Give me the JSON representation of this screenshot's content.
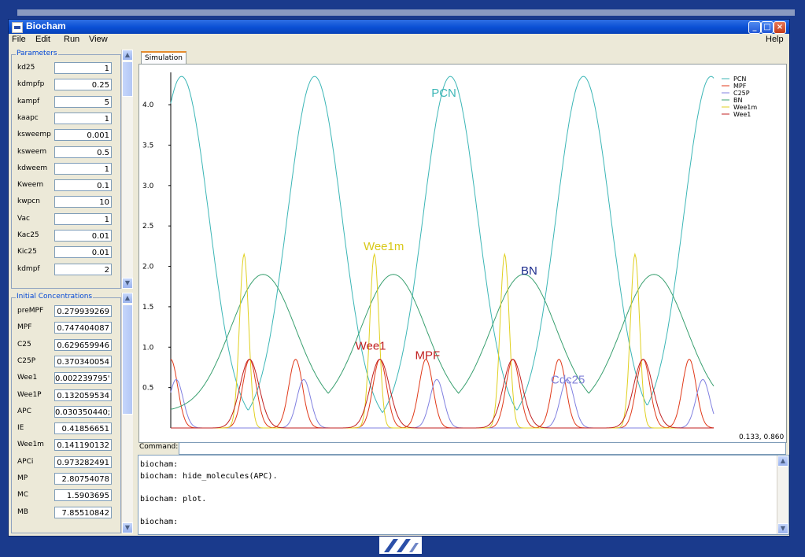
{
  "window": {
    "title": "Biocham"
  },
  "menu": {
    "left": [
      "File",
      "Edit",
      "Run",
      "View"
    ],
    "right": "Help"
  },
  "parameters": {
    "legend": "Parameters",
    "rows": [
      {
        "label": "kd25",
        "value": "1"
      },
      {
        "label": "kdmpfp",
        "value": "0.25"
      },
      {
        "label": "kampf",
        "value": "5"
      },
      {
        "label": "kaapc",
        "value": "1"
      },
      {
        "label": "ksweemp",
        "value": "0.001"
      },
      {
        "label": "ksweem",
        "value": "0.5"
      },
      {
        "label": "kdweem",
        "value": "1"
      },
      {
        "label": "Kweem",
        "value": "0.1"
      },
      {
        "label": "kwpcn",
        "value": "10"
      },
      {
        "label": "Vac",
        "value": "1"
      },
      {
        "label": "Kac25",
        "value": "0.01"
      },
      {
        "label": "Kic25",
        "value": "0.01"
      },
      {
        "label": "kdmpf",
        "value": "2"
      }
    ]
  },
  "concentrations": {
    "legend": "Initial Concentrations",
    "rows": [
      {
        "label": "preMPF",
        "value": "0.279939269"
      },
      {
        "label": "MPF",
        "value": "0.747404087"
      },
      {
        "label": "C25",
        "value": "0.629659946"
      },
      {
        "label": "C25P",
        "value": "0.370340054"
      },
      {
        "label": "Wee1",
        "value": "0.002239795'"
      },
      {
        "label": "Wee1P",
        "value": "0.132059534"
      },
      {
        "label": "APC",
        "value": "0.030350440;"
      },
      {
        "label": "IE",
        "value": "0.41856651"
      },
      {
        "label": "Wee1m",
        "value": "0.141190132"
      },
      {
        "label": "APCi",
        "value": "0.973282491"
      },
      {
        "label": "MP",
        "value": "2.80754078"
      },
      {
        "label": "MC",
        "value": "1.5903695"
      },
      {
        "label": "MB",
        "value": "7.85510842"
      }
    ]
  },
  "tabs": {
    "simulation": "Simulation"
  },
  "chart_data": {
    "type": "line",
    "ylim": [
      0,
      4.4
    ],
    "yticks": [
      "0.5",
      "1.0",
      "1.5",
      "2.0",
      "2.5",
      "3.0",
      "3.5",
      "4.0"
    ],
    "legend_position": "top-right",
    "coordinate_readout": "0.133, 0.860",
    "series": [
      {
        "name": "PCN",
        "color": "#3cb6b6",
        "peaks": [
          0.02,
          0.265,
          0.515,
          0.76,
          0.995
        ],
        "max": 4.35,
        "min": 0.0,
        "width": 0.05,
        "shape": "wide"
      },
      {
        "name": "MPF",
        "color": "#e03a1a",
        "peaks": [
          0.0,
          0.145,
          0.23,
          0.385,
          0.47,
          0.63,
          0.715,
          0.87,
          0.955
        ],
        "max": 0.85,
        "min": 0.0,
        "width": 0.018,
        "shape": "narrow"
      },
      {
        "name": "C25P",
        "color": "#8080e0",
        "peaks": [
          0.01,
          0.245,
          0.49,
          0.73,
          0.98
        ],
        "max": 0.6,
        "min": 0.0,
        "width": 0.018,
        "shape": "narrow"
      },
      {
        "name": "BN",
        "color": "#3aa070",
        "peaks": [
          0.17,
          0.41,
          0.65,
          0.89
        ],
        "max": 1.9,
        "min": 0.2,
        "width": 0.06,
        "shape": "wide"
      },
      {
        "name": "Wee1m",
        "color": "#e0d020",
        "peaks": [
          0.135,
          0.375,
          0.615,
          0.855
        ],
        "max": 2.15,
        "min": 0.0,
        "width": 0.012,
        "shape": "narrow"
      },
      {
        "name": "Wee1",
        "color": "#c02020",
        "peaks": [
          0.145,
          0.385,
          0.63,
          0.87
        ],
        "max": 0.85,
        "min": 0.0,
        "width": 0.025,
        "shape": "narrow"
      }
    ],
    "annotations": [
      {
        "text": "PCN",
        "color": "#3cb6b6",
        "x": 0.48,
        "y": 4.1
      },
      {
        "text": "Wee1m",
        "color": "#d8c818",
        "x": 0.355,
        "y": 2.2
      },
      {
        "text": "BN",
        "color": "#1a2a8c",
        "x": 0.645,
        "y": 1.9
      },
      {
        "text": "Wee1",
        "color": "#c02020",
        "x": 0.34,
        "y": 0.97
      },
      {
        "text": "MPF",
        "color": "#c02020",
        "x": 0.45,
        "y": 0.85
      },
      {
        "text": "Cdc25",
        "color": "#8080d8",
        "x": 0.7,
        "y": 0.55
      }
    ]
  },
  "command": {
    "label": "Command:",
    "value": ""
  },
  "console": {
    "lines": [
      "biocham:",
      "biocham: hide_molecules(APC).",
      "",
      "biocham: plot.",
      "",
      "biocham:"
    ]
  }
}
